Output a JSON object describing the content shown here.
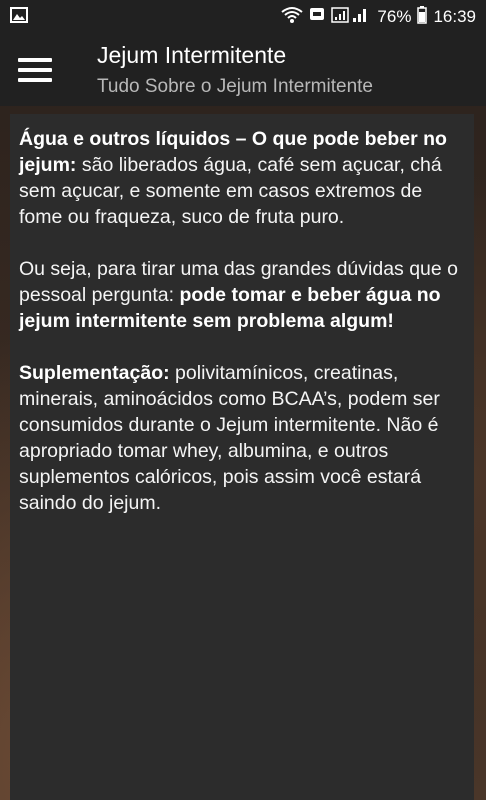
{
  "status": {
    "battery": "76%",
    "time": "16:39"
  },
  "app_bar": {
    "title": "Jejum Intermitente",
    "subtitle": "Tudo Sobre o Jejum Intermitente"
  },
  "article": {
    "p1_bold": "Água e outros líquidos – O que pode beber no jejum:",
    "p1_text": " são liberados água, café sem açucar, chá sem açucar, e somente em casos extremos de fome ou fraqueza, suco de fruta puro.",
    "p2_text": "Ou seja, para tirar uma das grandes dúvidas que o pessoal pergunta: ",
    "p2_bold": "pode tomar e beber água no jejum intermitente sem problema algum!",
    "p3_bold": "Suplementação:",
    "p3_text": " polivitamínicos, creatinas, minerais, aminoácidos como BCAA’s, podem ser consumidos durante o Jejum intermitente. Não é apropriado tomar whey, albumina, e outros suplementos calóricos, pois assim você estará saindo do jejum."
  },
  "icons": {
    "gallery": "image-icon",
    "wifi": "wifi-icon",
    "signal": "signal-icon",
    "battery": "battery-icon",
    "menu": "hamburger-menu-icon"
  }
}
